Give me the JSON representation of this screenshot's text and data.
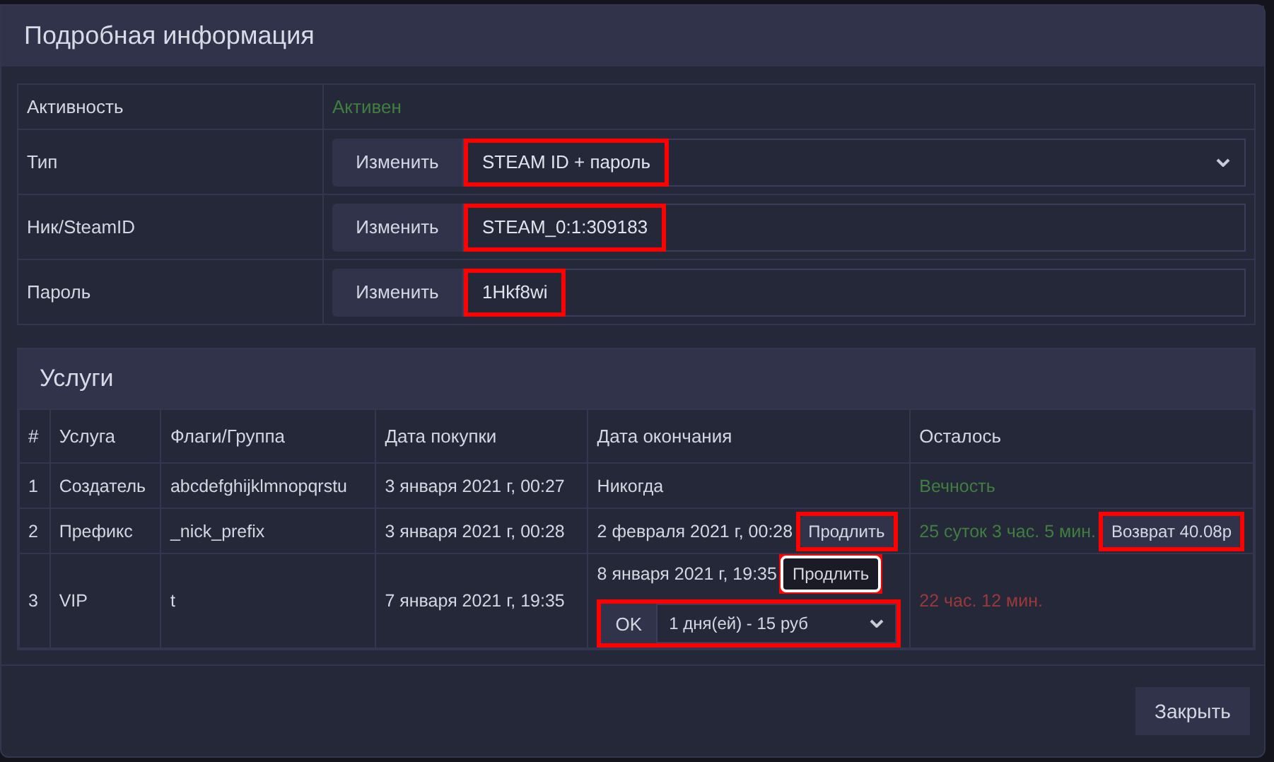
{
  "modal": {
    "title": "Подробная информация"
  },
  "details": [
    {
      "kind": "status",
      "label": "Активность",
      "value": "Активен",
      "color": "#3f7f3f"
    },
    {
      "kind": "select",
      "label": "Тип",
      "button": "Изменить",
      "value": "STEAM ID + пароль",
      "highlighted": true
    },
    {
      "kind": "input",
      "label": "Ник/SteamID",
      "button": "Изменить",
      "value": "STEAM_0:1:309183",
      "highlighted": true
    },
    {
      "kind": "input",
      "label": "Пароль",
      "button": "Изменить",
      "value": "1Hkf8wi",
      "highlighted": true
    }
  ],
  "services": {
    "title": "Услуги",
    "columns": [
      "#",
      "Услуга",
      "Флаги/Группа",
      "Дата покупки",
      "Дата окончания",
      "Осталось"
    ],
    "rows": [
      {
        "num": "1",
        "service": "Создатель",
        "flags": "abcdefghijklmnopqrstu",
        "purchased": "3 января 2021 г, 00:27",
        "ends": "Никогда",
        "remaining": "Вечность",
        "color": "#3f7f3f"
      },
      {
        "num": "2",
        "service": "Префикс",
        "flags": "_nick_prefix",
        "purchased": "3 января 2021 г, 00:28",
        "ends": "2 февраля 2021 г, 00:28",
        "extend": {
          "label": "Продлить",
          "focused": false,
          "highlighted": true
        },
        "remaining": "25 суток 3 час. 5 мин.",
        "color": "#3f7f3f",
        "refund": {
          "label": "Возврат 40.08р",
          "highlighted": true
        }
      },
      {
        "num": "3",
        "service": "VIP",
        "flags": "t",
        "purchased": "7 января 2021 г, 19:35",
        "ends": "8 января 2021 г, 19:35",
        "extend": {
          "label": "Продлить",
          "focused": true,
          "highlighted": true
        },
        "period": {
          "ok": "OK",
          "value": "1 дня(ей) - 15 руб",
          "highlighted": true
        },
        "remaining": "22 час. 12 мин.",
        "color": "#9b3a3a"
      }
    ]
  },
  "footer": {
    "close": "Закрыть"
  }
}
